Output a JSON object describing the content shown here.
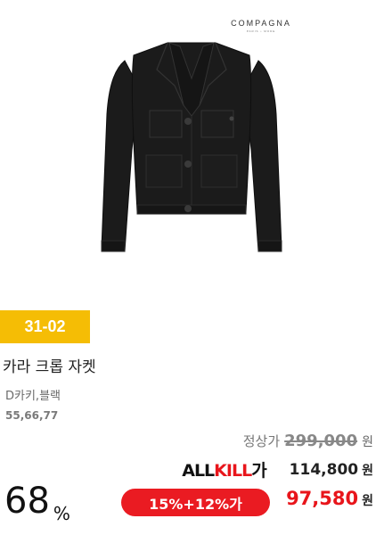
{
  "brand": {
    "name": "COMPAGNA",
    "sub": "PARIS • MODE"
  },
  "product": {
    "code": "31-02",
    "name": "카라 크롭 자켓",
    "colors": "D카키,블랙",
    "sizes": "55,66,77"
  },
  "pricing": {
    "regular_label": "정상가",
    "regular_price": "299,000",
    "currency": "원",
    "allkill_logo_black": "ALL",
    "allkill_logo_red": "KILL",
    "allkill_logo_suffix": "가",
    "allkill_price": "114,800",
    "discount_rate": "68",
    "discount_unit": "%",
    "coupon_label": "15%+12%가",
    "final_price": "97,580"
  },
  "colors": {
    "badge": "#f5bd05",
    "accent_red": "#e8151b",
    "jacket": "#1a1a1a"
  }
}
